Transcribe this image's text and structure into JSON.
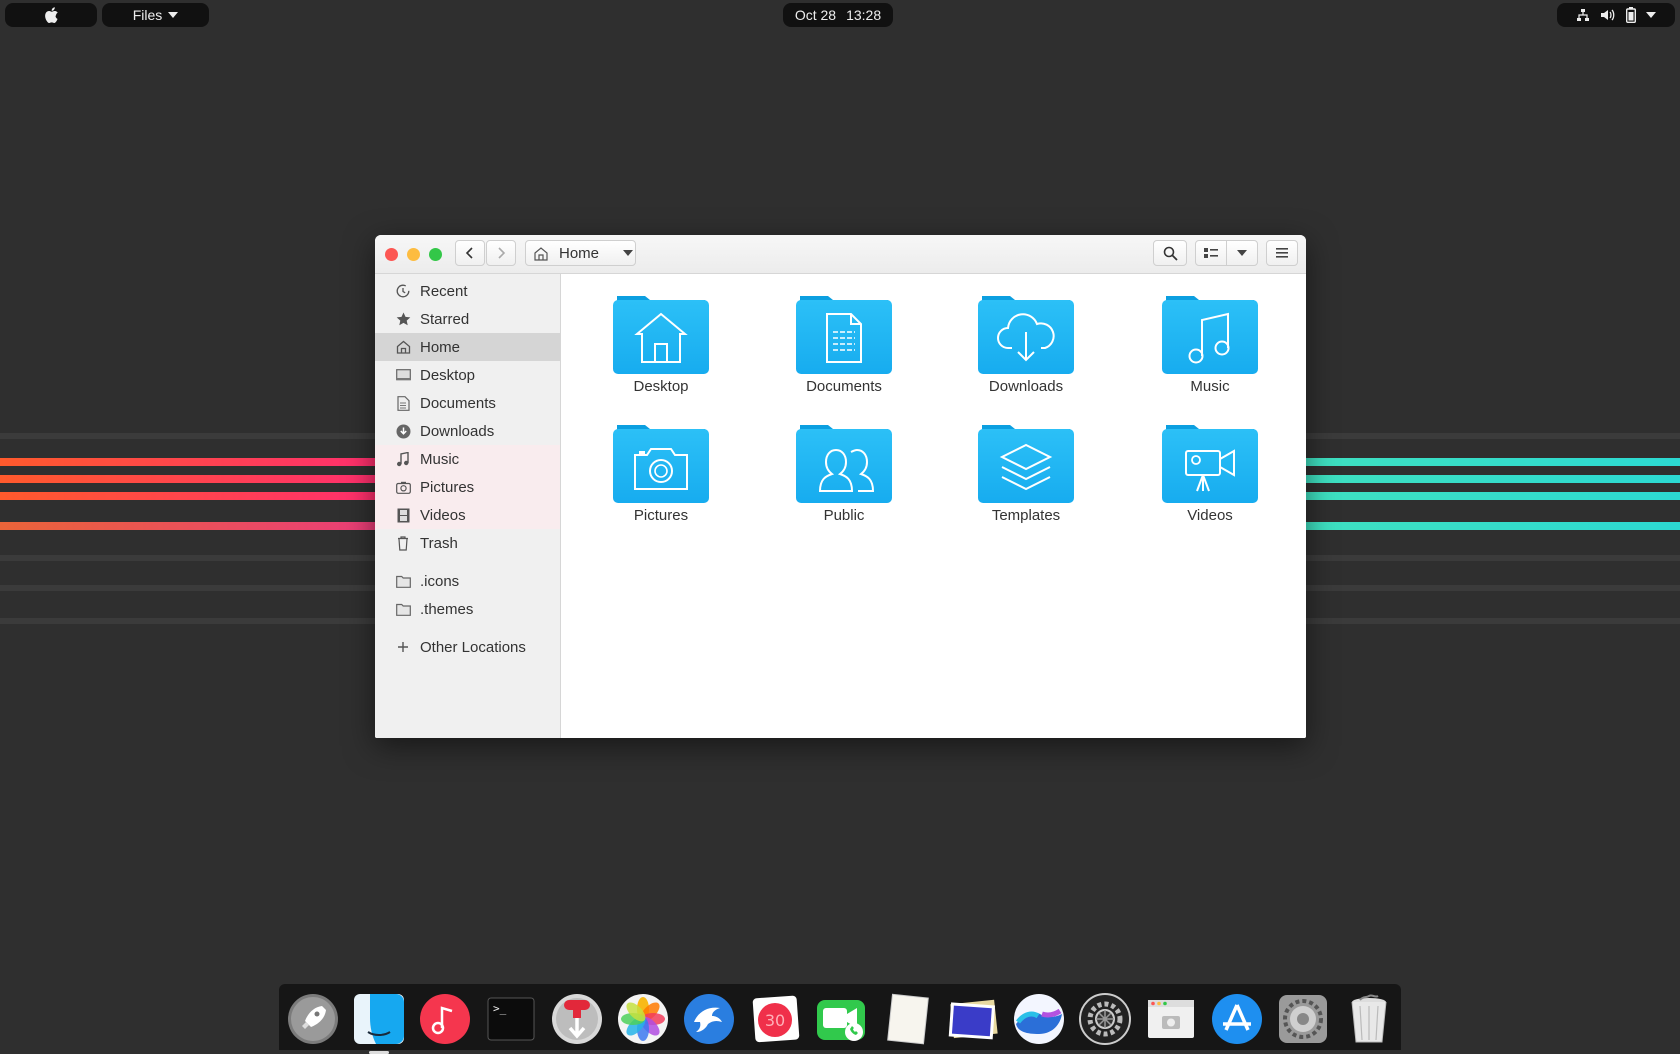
{
  "topbar": {
    "app_menu": "Files",
    "clock": {
      "date": "Oct 28",
      "time": "13:28"
    }
  },
  "window": {
    "path_label": "Home"
  },
  "sidebar": {
    "items": [
      {
        "label": "Recent",
        "icon": "clock-icon"
      },
      {
        "label": "Starred",
        "icon": "star-icon"
      },
      {
        "label": "Home",
        "icon": "home-icon",
        "active": true
      },
      {
        "label": "Desktop",
        "icon": "desktop-icon"
      },
      {
        "label": "Documents",
        "icon": "document-icon"
      },
      {
        "label": "Downloads",
        "icon": "download-icon"
      },
      {
        "label": "Music",
        "icon": "music-note-icon"
      },
      {
        "label": "Pictures",
        "icon": "camera-icon"
      },
      {
        "label": "Videos",
        "icon": "film-icon"
      },
      {
        "label": "Trash",
        "icon": "trash-icon"
      }
    ],
    "bookmarks": [
      {
        "label": ".icons",
        "icon": "folder-icon"
      },
      {
        "label": ".themes",
        "icon": "folder-icon"
      }
    ],
    "other_locations": "Other Locations"
  },
  "content": {
    "folders": [
      {
        "label": "Desktop",
        "icon": "house-glyph"
      },
      {
        "label": "Documents",
        "icon": "document-glyph"
      },
      {
        "label": "Downloads",
        "icon": "cloud-download-glyph"
      },
      {
        "label": "Music",
        "icon": "music-glyph"
      },
      {
        "label": "Pictures",
        "icon": "camera-glyph"
      },
      {
        "label": "Public",
        "icon": "people-glyph"
      },
      {
        "label": "Templates",
        "icon": "layers-glyph"
      },
      {
        "label": "Videos",
        "icon": "video-camera-glyph"
      }
    ]
  },
  "dock": {
    "apps": [
      "launchpad-rocket-icon",
      "files-finder-icon",
      "music-icon",
      "terminal-icon",
      "downloader-icon",
      "photos-icon",
      "mail-eagle-icon",
      "calendar-icon",
      "facetime-icon",
      "notes-icon",
      "image-viewer-icon",
      "weather-icon",
      "settings-gear-icon",
      "screenshot-icon",
      "app-store-icon",
      "system-preferences-icon",
      "trash-icon"
    ],
    "calendar_day": "30",
    "terminal_prompt": ">_"
  },
  "colors": {
    "folder_blue": "#1fb4f2",
    "folder_blue_dark": "#0a9ee0",
    "accent_red": "#fc5753",
    "accent_yellow": "#fdbc40",
    "accent_green": "#33c748"
  }
}
